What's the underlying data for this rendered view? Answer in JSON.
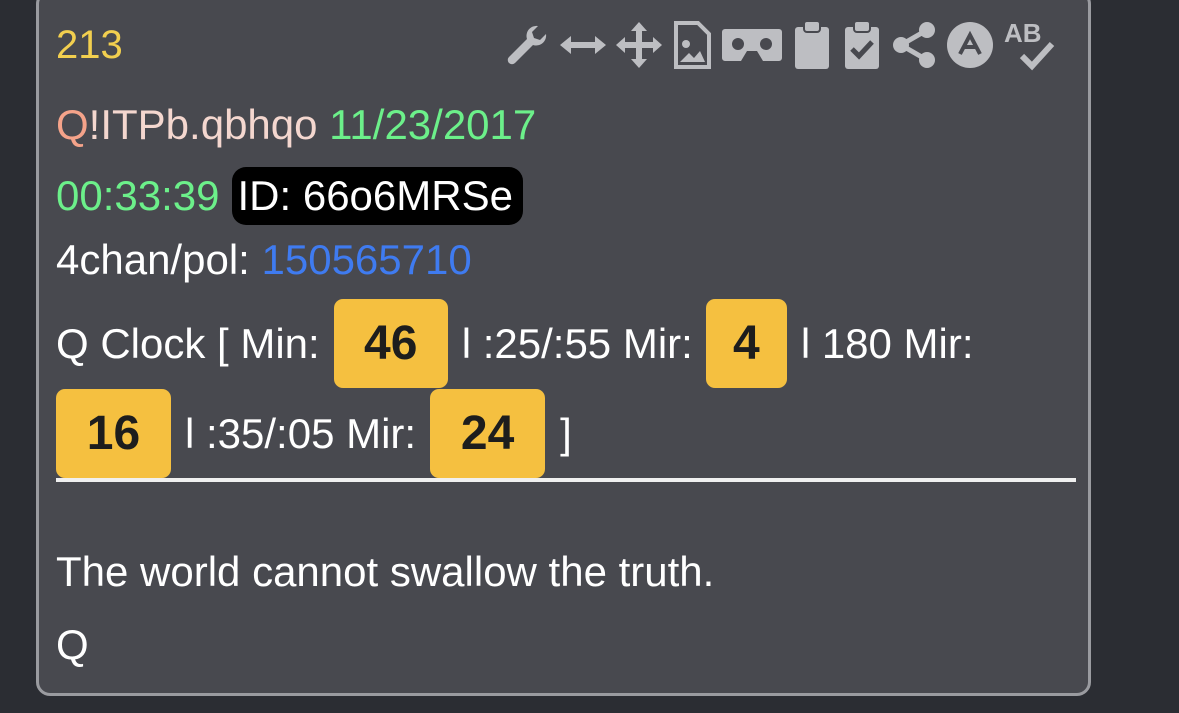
{
  "post": {
    "number": "213",
    "trip_q": "Q",
    "trip_code": "!ITPb.qbhqo",
    "date": "11/23/2017",
    "time": "00:33:39",
    "id_label": "ID: 66o6MRSe",
    "board": "4chan/pol:",
    "post_link": "150565710",
    "clock": {
      "prefix": "Q Clock [ Min:",
      "min": "46",
      "sep1": "l :25/:55 Mir:",
      "mir1": "4",
      "sep2": "l 180 Mir:",
      "mir2": "16",
      "sep3": "l :35/:05 Mir:",
      "mir3": "24",
      "suffix": "]"
    },
    "message": "The world cannot swallow the truth.",
    "signature": "Q"
  },
  "toolbar": {
    "icons": [
      "wrench-icon",
      "horizontal-arrows-icon",
      "move-icon",
      "image-file-icon",
      "vr-headset-icon",
      "clipboard-icon",
      "clipboard-check-icon",
      "share-icon",
      "circle-a-icon",
      "spellcheck-icon"
    ]
  },
  "colors": {
    "background": "#2b2d33",
    "card": "#48494f",
    "number": "#f2cf4f",
    "date": "#6cf08a",
    "link": "#3f7bf0",
    "badge": "#f5c040",
    "icon": "#bdbec2"
  }
}
